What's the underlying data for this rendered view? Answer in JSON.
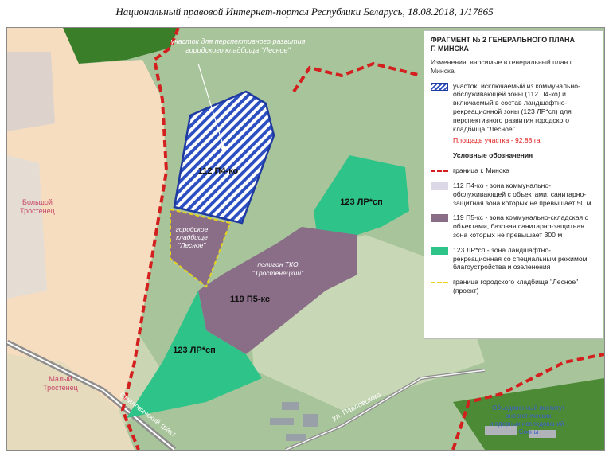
{
  "header": {
    "text": "Национальный правовой Интернет-портал Республики Беларусь, 18.08.2018, 1/17865"
  },
  "map": {
    "labels": {
      "reserve_note_1": "участок для перспективного развития",
      "reserve_note_2": "городского кладбища \"Лесное\"",
      "zone_p4": "112 П4-ко",
      "zone_lr_east": "123 ЛР*сп",
      "zone_lr_south": "123 ЛР*сп",
      "zone_p5": "119 П5-кс",
      "cemetery_1": "городское",
      "cemetery_2": "кладбище",
      "cemetery_3": "\"Лесное\"",
      "landfill_1": "полигон ТКО",
      "landfill_2": "\"Тростенецкий\"",
      "bolshoy_1": "Большой",
      "bolshoy_2": "Тростенец",
      "maly_1": "Малый",
      "maly_2": "Тростенец",
      "road_smil": "Смиловичский тракт",
      "road_pavl": "ул. Павловского",
      "inst_1": "Объединенный институт",
      "inst_2": "энергетических",
      "inst_3": "и ядерных исследований -",
      "inst_4": "Сосны"
    },
    "colors": {
      "forest": "#a8c49a",
      "residential": "#f7ddc0",
      "zone_p4_fill": "#2c4fc2",
      "zone_p5_fill": "#8a6e88",
      "zone_lr_fill": "#2ec489",
      "city_border": "#d41f1f",
      "cemetery_border": "#e6d21a",
      "dark_forest": "#3b7e2a"
    }
  },
  "legend": {
    "title_1": "ФРАГМЕНТ № 2 ГЕНЕРАЛЬНОГО ПЛАНА",
    "title_2": "Г. МИНСКА",
    "subtitle": "Изменения, вносимые в генеральный план г. Минска",
    "hatch_text": "участок, исключаемый из коммунально-обслуживающей зоны (112 П4-ко) и включаемый в состав ландшафтно-рекреационной зоны (123 ЛР*сп) для перспективного развития городского кладбища \"Лесное\"",
    "area_text": "Площадь участка - 92,88 га",
    "conventions_title": "Условные обозначения",
    "items": [
      {
        "icon": "dashed-red-line-icon",
        "text": "граница г. Минска"
      },
      {
        "icon": "lilac-square-icon",
        "text": "112 П4-ко - зона коммунально-обслуживающей с объектами, санитарно-защитная зона которых не превышает 50 м"
      },
      {
        "icon": "purple-square-icon",
        "text": "119 П5-кс - зона коммунально-складская с объектами, базовая санитарно-защитная зона которых не превышает 300 м"
      },
      {
        "icon": "green-square-icon",
        "text": "123 ЛР*сп - зона ландшафтно-рекреационная со специальным режимом благоустройства и озеленения"
      },
      {
        "icon": "dashed-yellow-line-icon",
        "text": "граница городского кладбища \"Лесное\" (проект)"
      }
    ]
  }
}
